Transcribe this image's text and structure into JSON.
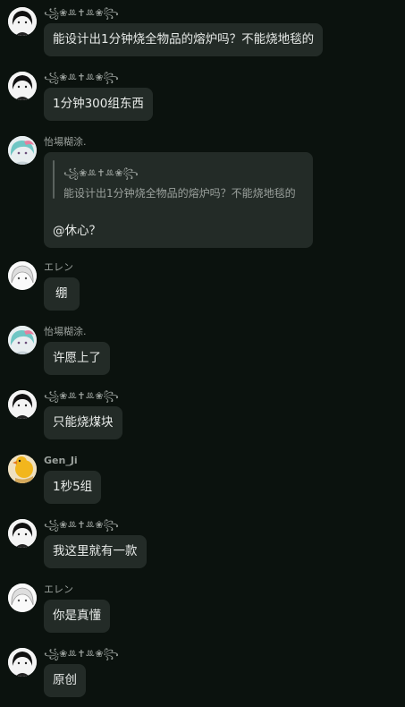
{
  "messages": [
    {
      "sender": "꧁❀ꔛ✝ꔛ❀꧂",
      "avatar": "avatar-anime-black-hair-icon",
      "text": "能设计出1分钟烧全物品的熔炉吗？不能烧地毯的"
    },
    {
      "sender": "꧁❀ꔛ✝ꔛ❀꧂",
      "avatar": "avatar-anime-black-hair-icon",
      "text": "1分钟300组东西"
    },
    {
      "sender": "怡場糊涂.",
      "avatar": "avatar-anime-colorful-hair-icon",
      "quote": {
        "sender": "꧁❀ꔛ✝ꔛ❀꧂",
        "text": "能设计出1分钟烧全物品的熔炉吗？不能烧地毯的"
      },
      "text": "@休心？"
    },
    {
      "sender": "エレン",
      "avatar": "avatar-anime-white-hair-icon",
      "text": "绷"
    },
    {
      "sender": "怡場糊涂.",
      "avatar": "avatar-anime-colorful-hair-icon",
      "text": "许愿上了"
    },
    {
      "sender": "꧁❀ꔛ✝ꔛ❀꧂",
      "avatar": "avatar-anime-black-hair-icon",
      "text": "只能烧煤块"
    },
    {
      "sender": "Gen_Ji",
      "avatar": "avatar-yellow-duck-icon",
      "text": "1秒5组"
    },
    {
      "sender": "꧁❀ꔛ✝ꔛ❀꧂",
      "avatar": "avatar-anime-black-hair-icon",
      "text": "我这里就有一款"
    },
    {
      "sender": "エレン",
      "avatar": "avatar-anime-white-hair-icon",
      "text": "你是真懂"
    },
    {
      "sender": "꧁❀ꔛ✝ꔛ❀꧂",
      "avatar": "avatar-anime-black-hair-icon",
      "text": "原创"
    }
  ],
  "colors": {
    "background": "#0b120e",
    "bubble": "#232b27",
    "text": "#e8ebe9",
    "muted_text": "#9aa09c"
  }
}
